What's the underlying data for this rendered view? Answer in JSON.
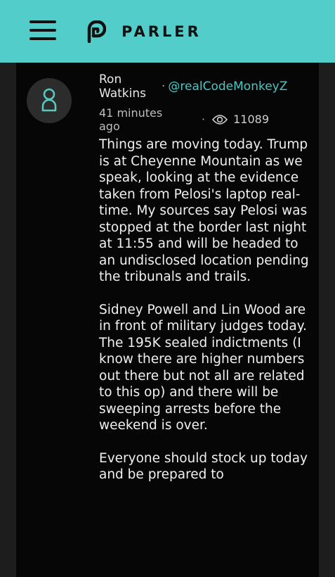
{
  "header": {
    "app_name": "PARLER",
    "menu_icon": "hamburger-menu-icon",
    "logo_icon": "parler-p-logo-icon",
    "background_color": "#52cdc9"
  },
  "post": {
    "author": {
      "name": "Ron Watkins",
      "handle": "@realCodeMonkeyZ",
      "avatar_icon": "user-avatar-icon"
    },
    "separator": "·",
    "timestamp": "41 minutes ago",
    "views": {
      "icon": "eye-icon",
      "count": "11089"
    },
    "body": {
      "paragraph_1": "Things are moving today. Trump is at Cheyenne Mountain as we speak, looking at the evidence taken from Pelosi's laptop real-time. My sources say Pelosi was stopped at the border last night at 11:55 and will be headed to an undisclosed location pending the tribunals and trails.",
      "paragraph_2": "Sidney Powell and Lin Wood are in front of military judges today. The 195K sealed indictments (I know there are higher numbers out there but not all are related to this op) and there will be sweeping arrests before the weekend is over.",
      "paragraph_3": "Everyone should stock up today and be prepared to"
    },
    "accent_color": "#4ec6c2"
  }
}
